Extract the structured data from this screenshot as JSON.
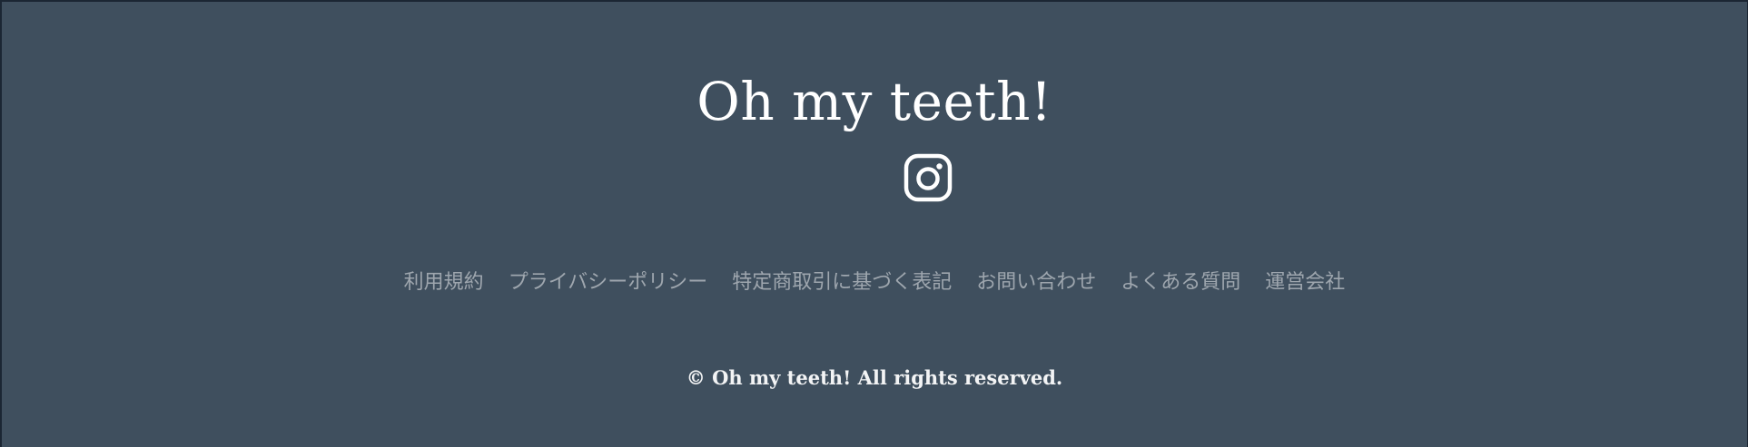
{
  "footer": {
    "brand": "Oh my teeth!",
    "social": {
      "icon": "instagram-icon"
    },
    "links": [
      {
        "label": "利用規約"
      },
      {
        "label": "プライバシーポリシー"
      },
      {
        "label": "特定商取引に基づく表記"
      },
      {
        "label": "お問い合わせ"
      },
      {
        "label": "よくある質問"
      },
      {
        "label": "運営会社"
      }
    ],
    "copyright": "© Oh my teeth! All rights reserved."
  },
  "colors": {
    "background": "#3f4f5e",
    "text": "#ffffff",
    "link": "#9ea6ae"
  }
}
